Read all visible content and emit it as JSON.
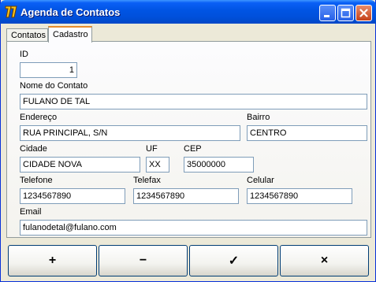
{
  "window": {
    "title": "Agenda de Contatos"
  },
  "tabs": [
    {
      "label": "Contatos"
    },
    {
      "label": "Cadastro"
    }
  ],
  "form": {
    "id": {
      "label": "ID",
      "value": "1"
    },
    "nome": {
      "label": "Nome do Contato",
      "value": "FULANO DE TAL"
    },
    "endereco": {
      "label": "Endereço",
      "value": "RUA PRINCIPAL, S/N"
    },
    "bairro": {
      "label": "Bairro",
      "value": "CENTRO"
    },
    "cidade": {
      "label": "Cidade",
      "value": "CIDADE NOVA"
    },
    "uf": {
      "label": "UF",
      "value": "XX"
    },
    "cep": {
      "label": "CEP",
      "value": "35000000"
    },
    "telefone": {
      "label": "Telefone",
      "value": "1234567890"
    },
    "telefax": {
      "label": "Telefax",
      "value": "1234567890"
    },
    "celular": {
      "label": "Celular",
      "value": "1234567890"
    },
    "email": {
      "label": "Email",
      "value": "fulanodetal@fulano.com"
    }
  },
  "toolbar": {
    "add_label": "+",
    "remove_label": "−",
    "confirm_label": "✓",
    "cancel_label": "×"
  },
  "icons": {
    "app": "delphi-app-icon",
    "minimize": "minimize-icon",
    "maximize": "maximize-icon",
    "close": "close-icon"
  },
  "colors": {
    "titlebar": "#0054e3",
    "window_bg": "#ece9d8",
    "tab_accent": "#e68b2c",
    "close_button": "#c4411a"
  }
}
